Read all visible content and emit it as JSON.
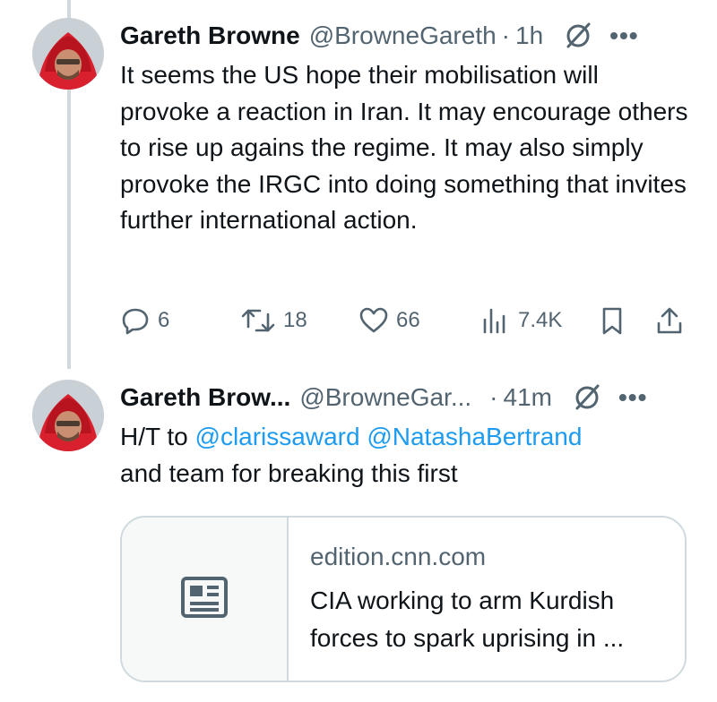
{
  "tweets": [
    {
      "author_name": "Gareth Browne",
      "handle": "@BrowneGareth",
      "time": "1h",
      "verified_icon": "verified-badge-icon",
      "text": "It seems the US hope their mobilisation will provoke a reaction in Iran. It may encourage others to rise up agains the regime. It may also simply provoke the IRGC into doing something that invites further international action.",
      "actions": {
        "replies": "6",
        "reposts": "18",
        "likes": "66",
        "views": "7.4K"
      }
    },
    {
      "author_name": "Gareth Brow...",
      "handle": "@BrowneGar...",
      "time": "41m",
      "verified_icon": "verified-badge-icon",
      "text_before": "H/T to ",
      "mention_1": "@clarissaward",
      "mention_2": "@NatashaBertrand",
      "text_after": "and team for breaking this first",
      "card": {
        "domain": "edition.cnn.com",
        "title": "CIA working to arm Kurdish forces to spark uprising in ..."
      }
    }
  ],
  "separator": "·",
  "more_glyph": "•••",
  "colors": {
    "link": "#1d9bf0",
    "secondary_text": "#536471",
    "primary_text": "#0f1419",
    "thread_line": "#cfd9de"
  }
}
